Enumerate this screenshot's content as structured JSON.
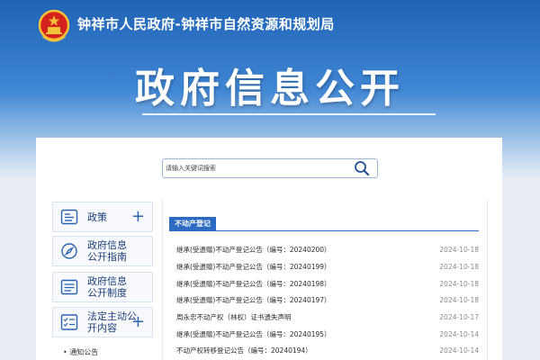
{
  "header": {
    "site_title": "钟祥市人民政府-钟祥市自然资源和规划局",
    "main_title": "政府信息公开"
  },
  "search": {
    "placeholder": "请输入关键词搜索",
    "icon": "search-icon"
  },
  "sidebar": {
    "items": [
      {
        "label_line1": "政策",
        "label_line2": "",
        "icon": "document-card-icon",
        "has_plus": true
      },
      {
        "label_line1": "政府信息",
        "label_line2": "公开指南",
        "icon": "compass-icon",
        "has_plus": false
      },
      {
        "label_line1": "政府信息",
        "label_line2": "公开制度",
        "icon": "list-icon",
        "has_plus": false
      },
      {
        "label_line1": "法定主动公",
        "label_line2": "开内容",
        "icon": "checklist-icon",
        "has_plus": true
      }
    ],
    "plus_symbol": "+",
    "subnav_item": "• 通知公告"
  },
  "main": {
    "tab_label": "不动产登记",
    "rows": [
      {
        "title": "继承(受遗赠)不动产登记公告（编号：20240200）",
        "date": "2024-10-18"
      },
      {
        "title": "继承(受遗赠)不动产登记公告（编号：20240199）",
        "date": "2024-10-18"
      },
      {
        "title": "继承(受遗赠)不动产登记公告（编号：20240198）",
        "date": "2024-10-18"
      },
      {
        "title": "继承(受遗赠)不动产登记公告（编号：20240197）",
        "date": "2024-10-18"
      },
      {
        "title": "周永忠不动产权（林权）证书遗失声明",
        "date": "2024-10-17"
      },
      {
        "title": "继承(受遗赠)不动产登记公告（编号：20240195）",
        "date": "2024-10-14"
      },
      {
        "title": "不动产权转移登记公告（编号：20240194）",
        "date": "2024-10-14"
      }
    ]
  },
  "colors": {
    "banner_top": "#1f63b5",
    "accent": "#2c6bc1",
    "sidebar_text": "#1d3f7a",
    "date": "#8a8a8a"
  }
}
